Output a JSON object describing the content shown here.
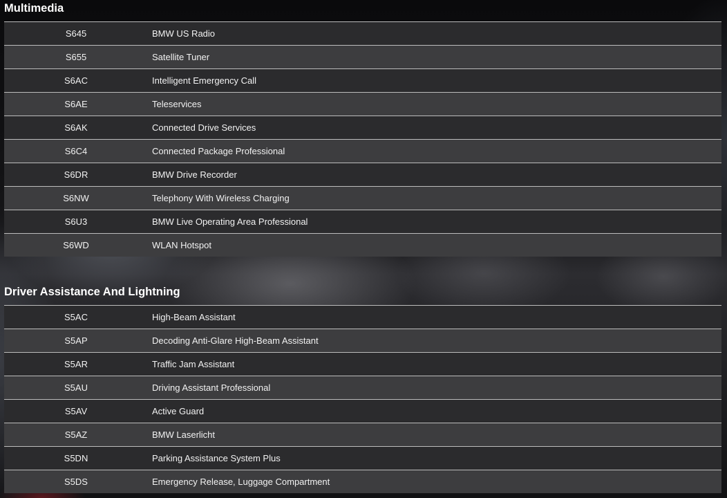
{
  "sections": [
    {
      "title": "Multimedia",
      "rows": [
        {
          "code": "S645",
          "desc": "BMW US Radio"
        },
        {
          "code": "S655",
          "desc": "Satellite Tuner"
        },
        {
          "code": "S6AC",
          "desc": "Intelligent Emergency Call"
        },
        {
          "code": "S6AE",
          "desc": "Teleservices"
        },
        {
          "code": "S6AK",
          "desc": "Connected Drive Services"
        },
        {
          "code": "S6C4",
          "desc": "Connected Package Professional"
        },
        {
          "code": "S6DR",
          "desc": "BMW Drive Recorder"
        },
        {
          "code": "S6NW",
          "desc": "Telephony With Wireless Charging"
        },
        {
          "code": "S6U3",
          "desc": "BMW Live Operating Area Professional"
        },
        {
          "code": "S6WD",
          "desc": "WLAN Hotspot"
        }
      ]
    },
    {
      "title": "Driver Assistance And Lightning",
      "rows": [
        {
          "code": "S5AC",
          "desc": "High-Beam Assistant"
        },
        {
          "code": "S5AP",
          "desc": "Decoding Anti-Glare High-Beam Assistant"
        },
        {
          "code": "S5AR",
          "desc": "Traffic Jam Assistant"
        },
        {
          "code": "S5AU",
          "desc": "Driving Assistant Professional"
        },
        {
          "code": "S5AV",
          "desc": "Active Guard"
        },
        {
          "code": "S5AZ",
          "desc": "BMW Laserlicht"
        },
        {
          "code": "S5DN",
          "desc": "Parking Assistance System Plus"
        },
        {
          "code": "S5DS",
          "desc": "Emergency Release, Luggage Compartment"
        }
      ]
    }
  ]
}
